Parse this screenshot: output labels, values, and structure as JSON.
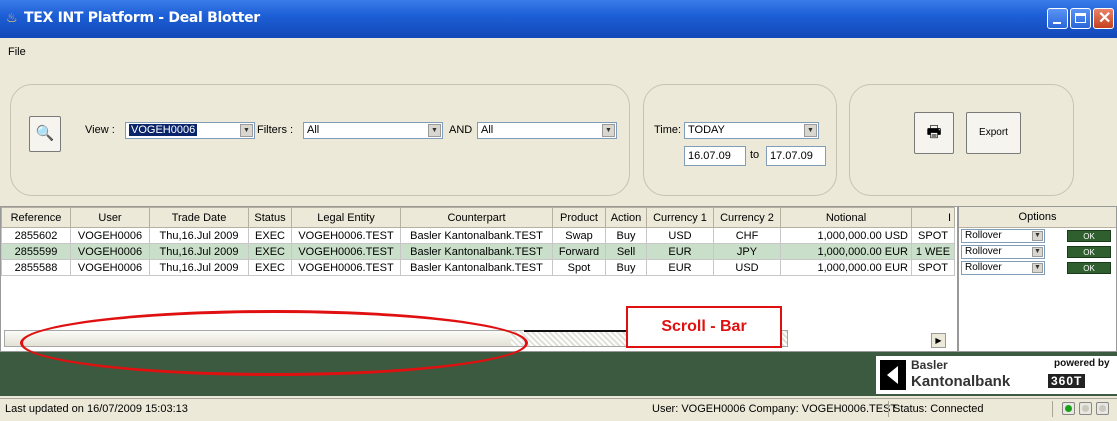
{
  "window": {
    "title": "TEX INT Platform - Deal Blotter"
  },
  "menu": {
    "file": "File"
  },
  "toolbar": {
    "view_label": "View :",
    "view_value": "VOGEH0006",
    "filters_label": "Filters :",
    "filters_value": "All",
    "and_label": "AND",
    "and_value": "All",
    "time_label": "Time:",
    "time_value": "TODAY",
    "date_from": "16.07.09",
    "to_label": "to",
    "date_to": "17.07.09",
    "export_label": "Export"
  },
  "grid": {
    "columns": [
      "Reference",
      "User",
      "Trade Date",
      "Status",
      "Legal Entity",
      "Counterpart",
      "Product",
      "Action",
      "Currency 1",
      "Currency 2",
      "Notional",
      "I"
    ],
    "rows": [
      [
        "2855602",
        "VOGEH0006",
        "Thu,16.Jul 2009",
        "EXEC",
        "VOGEH0006.TEST",
        "Basler Kantonalbank.TEST",
        "Swap",
        "Buy",
        "USD",
        "CHF",
        "1,000,000.00 USD",
        "SPOT"
      ],
      [
        "2855599",
        "VOGEH0006",
        "Thu,16.Jul 2009",
        "EXEC",
        "VOGEH0006.TEST",
        "Basler Kantonalbank.TEST",
        "Forward",
        "Sell",
        "EUR",
        "JPY",
        "1,000,000.00 EUR",
        "1 WEE"
      ],
      [
        "2855588",
        "VOGEH0006",
        "Thu,16.Jul 2009",
        "EXEC",
        "VOGEH0006.TEST",
        "Basler Kantonalbank.TEST",
        "Spot",
        "Buy",
        "EUR",
        "USD",
        "1,000,000.00 EUR",
        "SPOT"
      ]
    ]
  },
  "options": {
    "header": "Options",
    "rows": [
      {
        "select": "Rollover",
        "ok": "OK"
      },
      {
        "select": "Rollover",
        "ok": "OK"
      },
      {
        "select": "Rollover",
        "ok": "OK"
      }
    ]
  },
  "annotation": {
    "callout": "Scroll - Bar"
  },
  "branding": {
    "bank_line1": "Basler",
    "bank_line2": "Kantonalbank",
    "powered_by": "powered by",
    "powered_logo": "360T"
  },
  "status": {
    "updated": "Last updated on 16/07/2009 15:03:13",
    "user": "User: VOGEH0006 Company: VOGEH0006.TEST",
    "connection": "Status:  Connected"
  },
  "colors": {
    "titlebar": "#1d5fd6",
    "band": "#3c5a3f",
    "callout": "#e01010",
    "highlight_row": "#c9dfc9"
  }
}
